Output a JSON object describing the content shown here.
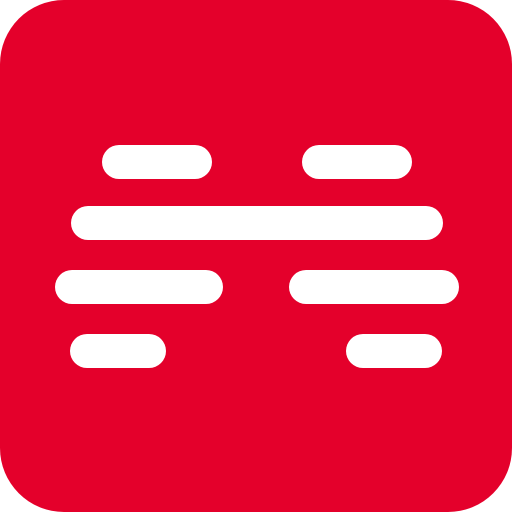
{
  "icon": {
    "semantic_name": "app-logo-icon",
    "background_color": "#E4002B",
    "bar_color": "#FFFFFF"
  }
}
